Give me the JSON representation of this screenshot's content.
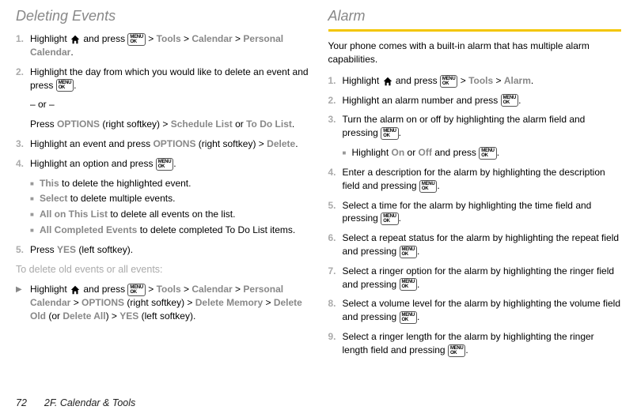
{
  "left": {
    "title": "Deleting Events",
    "step1_a": "Highlight ",
    "step1_b": " and press ",
    "step1_c": " > ",
    "tools": "Tools",
    "calendar": "Calendar",
    "personal_calendar": "Personal Calendar",
    "period": ".",
    "step2": "Highlight the day from which you would like to delete an event and press ",
    "or": "– or –",
    "press": "Press ",
    "options": "OPTIONS",
    "right_soft": " (right softkey) > ",
    "schedule_list": "Schedule List",
    "or_word": " or ",
    "todo": "To Do List",
    "step3_a": "Highlight an event and press ",
    "step3_b": " (right softkey) > ",
    "delete": "Delete",
    "step4": "Highlight an option and press ",
    "bullets": [
      {
        "bold": "This",
        "rest": " to delete the highlighted event."
      },
      {
        "bold": "Select",
        "rest": " to delete multiple events."
      },
      {
        "bold": "All on This List",
        "rest": " to delete all events on the list."
      },
      {
        "bold": "All Completed Events",
        "rest": " to delete completed To Do List items."
      }
    ],
    "step5_a": "Press ",
    "yes": "YES",
    "left_soft": " (left softkey).",
    "subhead": "To delete old events or all events:",
    "tri_a": "Highlight ",
    "tri_b": " and press ",
    "delete_memory": "Delete Memory",
    "delete_old": "Delete Old",
    "or_paren": " (or ",
    "delete_all": "Delete All",
    "close_paren_gt": ") > ",
    "left_soft2": " (left softkey)."
  },
  "right": {
    "title": "Alarm",
    "intro": "Your phone comes with a built-in alarm that has multiple alarm capabilities.",
    "s1_a": "Highlight ",
    "s1_b": " and press ",
    "gt": " > ",
    "tools": "Tools",
    "alarm": "Alarm",
    "period": ".",
    "s2": "Highlight an alarm number and press ",
    "s3": "Turn the alarm on or off by highlighting the alarm field and pressing ",
    "s3sub_a": "Highlight ",
    "on": "On",
    "or": " or ",
    "off": "Off",
    "s3sub_b": " and press ",
    "s4": "Enter a description for the alarm by highlighting the description field and pressing ",
    "s5": "Select a time for the alarm by highlighting the time field and pressing ",
    "s6": "Select a repeat status for the alarm by highlighting the repeat field and pressing ",
    "s7": "Select a ringer option for the alarm by highlighting the ringer field and pressing ",
    "s8": "Select a volume level for the alarm by highlighting the volume field and pressing ",
    "s9": "Select a ringer length for the alarm by highlighting the ringer length field and pressing "
  },
  "footer": {
    "page": "72",
    "chapter": "2F. Calendar & Tools"
  }
}
